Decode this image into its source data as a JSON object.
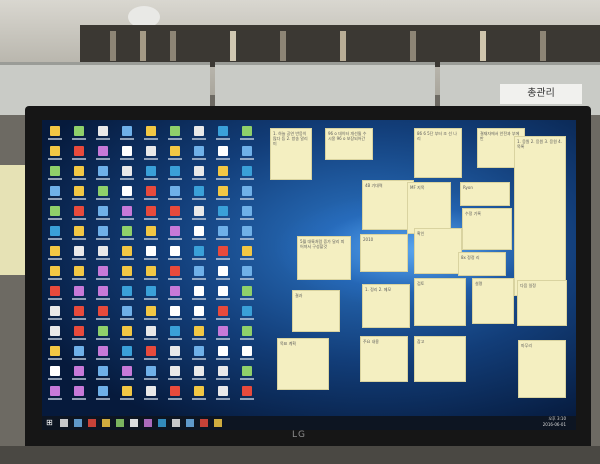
{
  "background": {
    "sign_text": "총관리",
    "brand": "LG"
  },
  "monitor": {
    "desktop": {
      "wallpaper": "windows-10-hero",
      "icons_columns": 9,
      "icons_rows": 14,
      "sticky_notes": [
        {
          "id": "n1",
          "text": "1. 하늘 공연 반응이 많다 등\n2. 방송 알리미"
        },
        {
          "id": "n2",
          "text": "96 o 데이터 개선될 수 시몽\n96 o 보장되어간"
        },
        {
          "id": "n3",
          "text": "86 6 5단 부터 조 선 나리"
        },
        {
          "id": "n4",
          "text": "결재자에서 안전과 부에\n반"
        },
        {
          "id": "n5",
          "text": "1. 응원\n2. 응원\n3. 응원\n4. 목록"
        },
        {
          "id": "n6",
          "text": "4B 기대력"
        },
        {
          "id": "n7",
          "text": "MF 지목"
        },
        {
          "id": "n8",
          "text": "Ryon"
        },
        {
          "id": "n9",
          "text": "수정 기록"
        },
        {
          "id": "n10",
          "text": "2010"
        },
        {
          "id": "n11",
          "text": "확인"
        },
        {
          "id": "n12",
          "text": "5월 대륙처럼 증가 달리\n피어져서 구성할것"
        },
        {
          "id": "n13",
          "text": "8x 정정 리"
        },
        {
          "id": "n14",
          "text": "결과"
        },
        {
          "id": "n15",
          "text": "1. 정리 2. 메모"
        },
        {
          "id": "n16",
          "text": "검토"
        },
        {
          "id": "n17",
          "text": "설명"
        },
        {
          "id": "n18",
          "text": "다음 일정"
        },
        {
          "id": "n19",
          "text": "목표 계획"
        },
        {
          "id": "n20",
          "text": "주요 내용"
        },
        {
          "id": "n21",
          "text": "참고"
        },
        {
          "id": "n22",
          "text": "마무리"
        }
      ]
    },
    "taskbar": {
      "time": "오후 3:10",
      "date": "2016-06-01"
    }
  },
  "left_postit": {
    "text": ""
  },
  "colors": {
    "wallpaper_blue": "#1e5fb3",
    "note_yellow": "#f4efc1"
  }
}
